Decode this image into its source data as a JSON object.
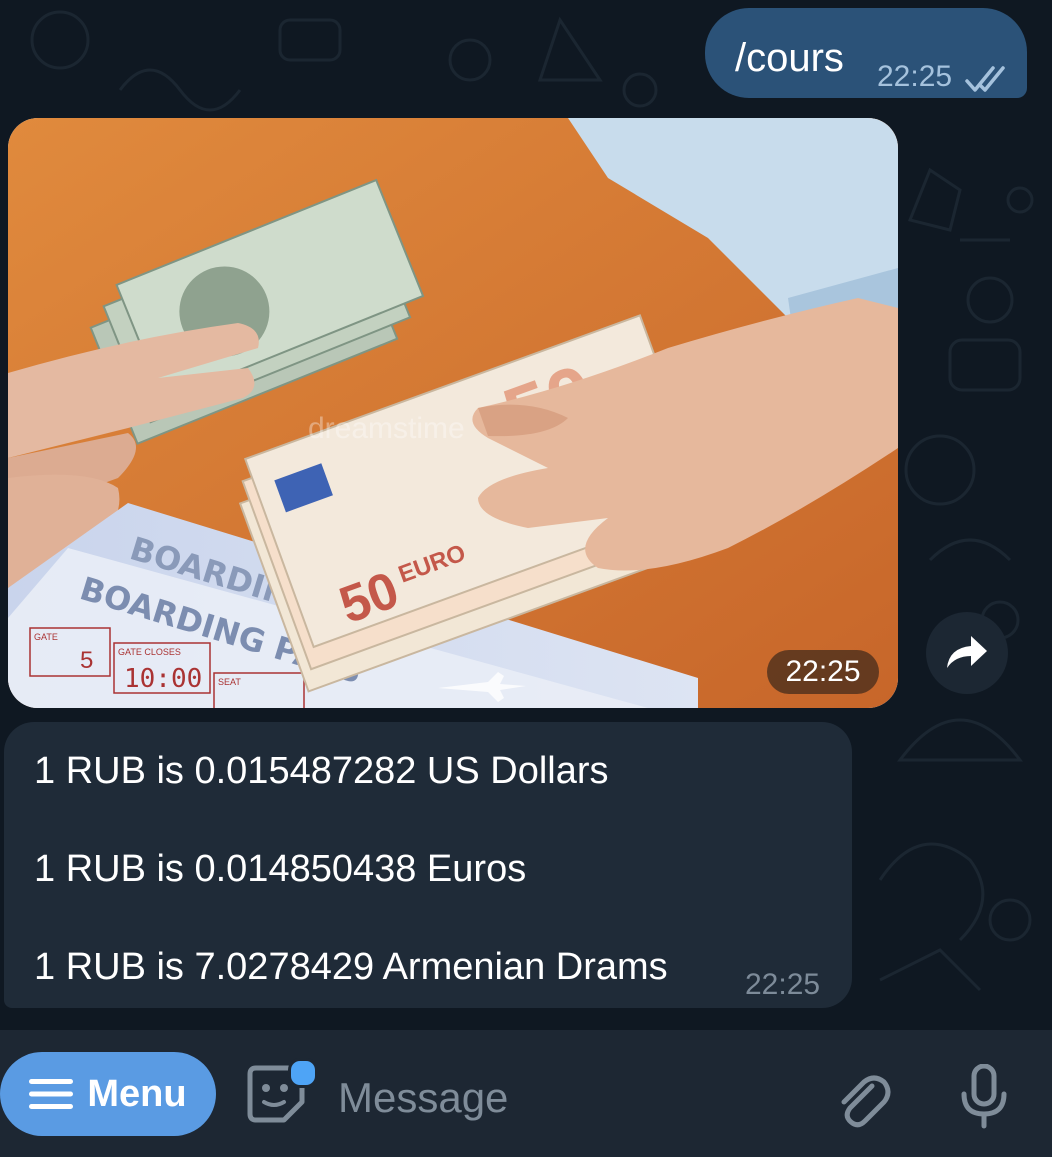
{
  "outgoing": {
    "text": "/cours",
    "time": "22:25",
    "status_icon": "double-check-icon"
  },
  "photo": {
    "time": "22:25",
    "share_icon": "share-arrow-icon",
    "pass_title": "BOARDING PASS",
    "gate_label": "GATE",
    "gate_value": "5",
    "gate_closes_label": "GATE CLOSES",
    "gate_closes_value": "10:00",
    "seat_label": "SEAT",
    "note_value": "50",
    "note_currency": "EURO",
    "watermark": "dreamstime"
  },
  "reply": {
    "lines": [
      "1 RUB is 0.015487282 US Dollars",
      "1 RUB is 0.014850438 Euros",
      "1 RUB is 7.0278429 Armenian Drams"
    ],
    "time": "22:25"
  },
  "composer": {
    "menu_label": "Menu",
    "placeholder": "Message",
    "icons": [
      "hamburger-icon",
      "sticker-icon",
      "paperclip-icon",
      "microphone-icon"
    ]
  },
  "colors": {
    "chat_bg": "#0f1822",
    "outgoing_bubble": "#2b5278",
    "incoming_bubble": "#1f2b38",
    "menu_button": "#5a9be3",
    "composer_bg": "#1d2733"
  }
}
